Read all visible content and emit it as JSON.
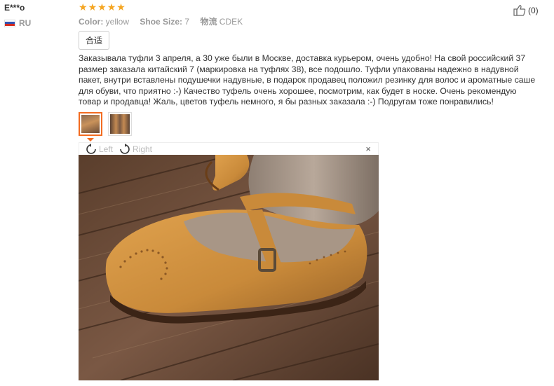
{
  "user": {
    "name": "E***o",
    "country": "RU"
  },
  "review": {
    "stars": [
      "★",
      "★",
      "★",
      "★",
      "★"
    ],
    "attributes": [
      {
        "label": "Color:",
        "value": "yellow"
      },
      {
        "label": "Shoe Size:",
        "value": "7"
      },
      {
        "label": "物流",
        "value": "CDEK"
      }
    ],
    "tag": "合适",
    "text": "Заказывала туфли 3 апреля, а 30 уже были в Москве, доставка курьером, очень удобно! На свой российский 37 размер заказала китайский 7 (маркировка на туфлях 38), все подошло. Туфли упакованы надежно в надувной пакет, внутри вставлены подушечки надувные, в подарок продавец положил резинку для волос и ароматные саше для обуви, что приятно :-) Качество туфель очень хорошее, посмотрим, как будет в носке. Очень рекомендую товар и продавца! Жаль, цветов туфель немного, я бы разных заказала :-) Подругам тоже понравились!",
    "helpful_count": "(0)"
  },
  "viewer": {
    "rotate_left": "Left",
    "rotate_right": "Right",
    "close": "×"
  },
  "colors": {
    "star": "#f5a623",
    "active_thumb": "#f36c21"
  }
}
